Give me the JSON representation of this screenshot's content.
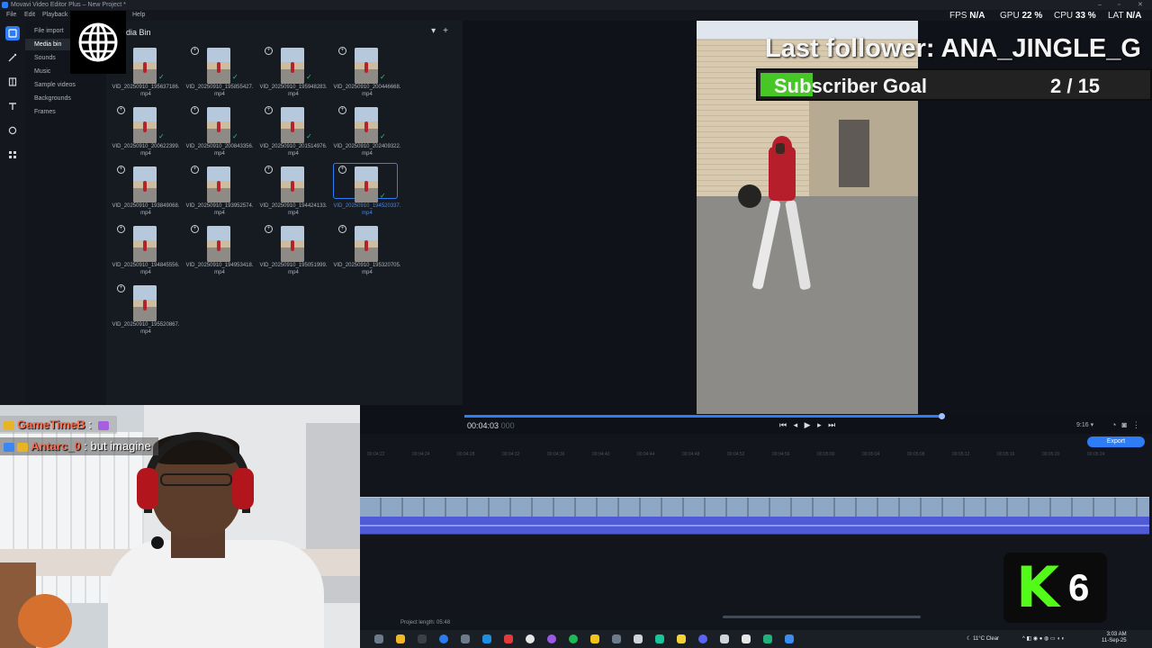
{
  "app": {
    "title": "Movavi Video Editor Plus – New Project *",
    "menu": [
      "File",
      "Edit",
      "Playback",
      "Help"
    ]
  },
  "import_nav": {
    "items": [
      "File import",
      "Media bin",
      "Sounds",
      "Music",
      "Sample videos",
      "Backgrounds",
      "Frames"
    ],
    "active": "Media bin"
  },
  "media_bin": {
    "title": "dia Bin",
    "files": [
      {
        "name": "VID_20250910_195637186.mp4",
        "checked": true
      },
      {
        "name": "VID_20250910_195855427.mp4",
        "checked": true
      },
      {
        "name": "VID_20250910_195948283.mp4",
        "checked": true
      },
      {
        "name": "VID_20250910_200446668.mp4",
        "checked": true
      },
      {
        "name": "VID_20250910_200622399.mp4",
        "checked": true
      },
      {
        "name": "VID_20250910_200843356.mp4",
        "checked": true
      },
      {
        "name": "VID_20250910_201514976.mp4",
        "checked": true
      },
      {
        "name": "VID_20250910_202409322.mp4",
        "checked": true
      },
      {
        "name": "VID_20250910_193849068.mp4",
        "checked": false
      },
      {
        "name": "VID_20250910_193952574.mp4",
        "checked": false
      },
      {
        "name": "VID_20250910_194424133.mp4",
        "checked": false
      },
      {
        "name": "VID_20250910_194520337.mp4",
        "checked": true,
        "selected": true
      },
      {
        "name": "VID_20250910_194845556.mp4",
        "checked": false
      },
      {
        "name": "VID_20250910_194953418.mp4",
        "checked": false
      },
      {
        "name": "VID_20250910_195051999.mp4",
        "checked": false
      },
      {
        "name": "VID_20250910_195320705.mp4",
        "checked": false
      },
      {
        "name": "VID_20250910_195520867.mp4",
        "checked": false
      }
    ]
  },
  "overlay": {
    "last_follower": "Last follower: ANA_JINGLE_G",
    "subscriber_goal_label": "Subscriber Goal",
    "subscriber_goal_count": "2 / 15",
    "subscriber_goal_progress": 0.1333
  },
  "stats": {
    "fps_label": "FPS",
    "fps_value": "N/A",
    "gpu_label": "GPU",
    "gpu_value": "22 %",
    "cpu_label": "CPU",
    "cpu_value": "33 %",
    "lat_label": "LAT",
    "lat_value": "N/A"
  },
  "playback": {
    "timecode": "00:04:03",
    "frames": "000",
    "aspect": "9:16",
    "progress": 0.99
  },
  "timeline": {
    "export_label": "Export",
    "project_length": "Project length: 05:48",
    "ruler": [
      "00:04:22",
      "00:04:24",
      "00:04:28",
      "00:04:32",
      "00:04:36",
      "00:04:40",
      "00:04:44",
      "00:04:48",
      "00:04:52",
      "00:04:56",
      "00:05:00",
      "00:05:04",
      "00:05:08",
      "00:05:12",
      "00:05:16",
      "00:05:20",
      "00:05:24"
    ]
  },
  "chat": [
    {
      "user": "GameTimeB",
      "text": ""
    },
    {
      "user": "Antarc_0",
      "text": "but imagine"
    }
  ],
  "kick": {
    "logo": "K",
    "count": "6"
  },
  "tray": {
    "weather": "11°C  Clear",
    "time": "3:03 AM",
    "date": "11-Sep-25"
  },
  "colors": {
    "accent": "#2f7df6",
    "check": "#35c26b",
    "kick_green": "#53fc18",
    "goal_fill": "#46c726",
    "chat_user": "#ff6b4d"
  }
}
